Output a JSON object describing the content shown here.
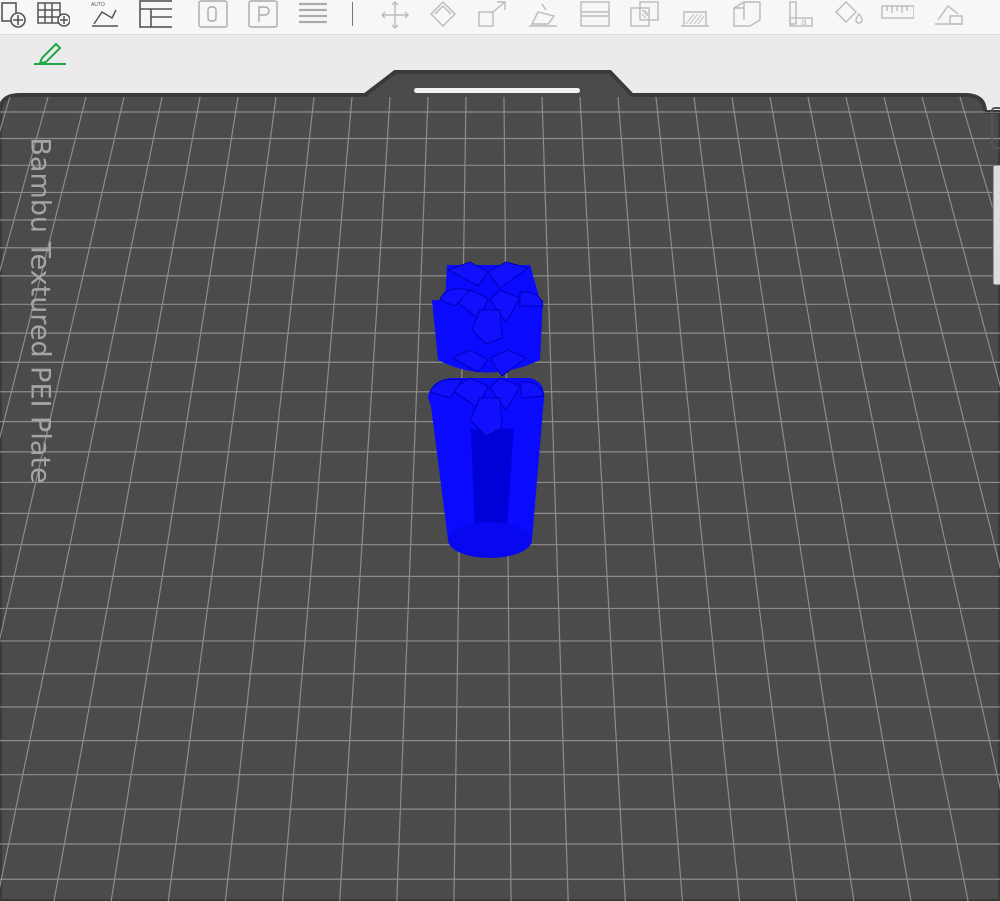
{
  "toolbar": {
    "buttons": [
      {
        "name": "add-object-icon"
      },
      {
        "name": "add-plate-icon"
      },
      {
        "name": "auto-orient-icon",
        "badge": "AUTO"
      },
      {
        "name": "arrange-icon"
      },
      {
        "name": "slice-plate-icon"
      },
      {
        "name": "plate-settings-icon"
      },
      {
        "name": "layers-icon"
      },
      {
        "name": "move-icon"
      },
      {
        "name": "rotate-icon"
      },
      {
        "name": "scale-icon"
      },
      {
        "name": "lay-on-face-icon"
      },
      {
        "name": "cut-icon"
      },
      {
        "name": "mesh-boolean-icon"
      },
      {
        "name": "support-paint-icon"
      },
      {
        "name": "seam-paint-icon"
      },
      {
        "name": "assembly-icon"
      },
      {
        "name": "text-icon"
      },
      {
        "name": "color-paint-icon"
      },
      {
        "name": "measure-icon"
      },
      {
        "name": "more-tools-icon"
      }
    ]
  },
  "edit_icon": "pencil-edit-icon",
  "plate": {
    "label": "Bambu Textured PEI Plate",
    "surface_color": "#4a4b4a",
    "grid_color": "#8c8c8c"
  },
  "model": {
    "color": "#0a0aff",
    "shade_color": "#0000b4"
  }
}
